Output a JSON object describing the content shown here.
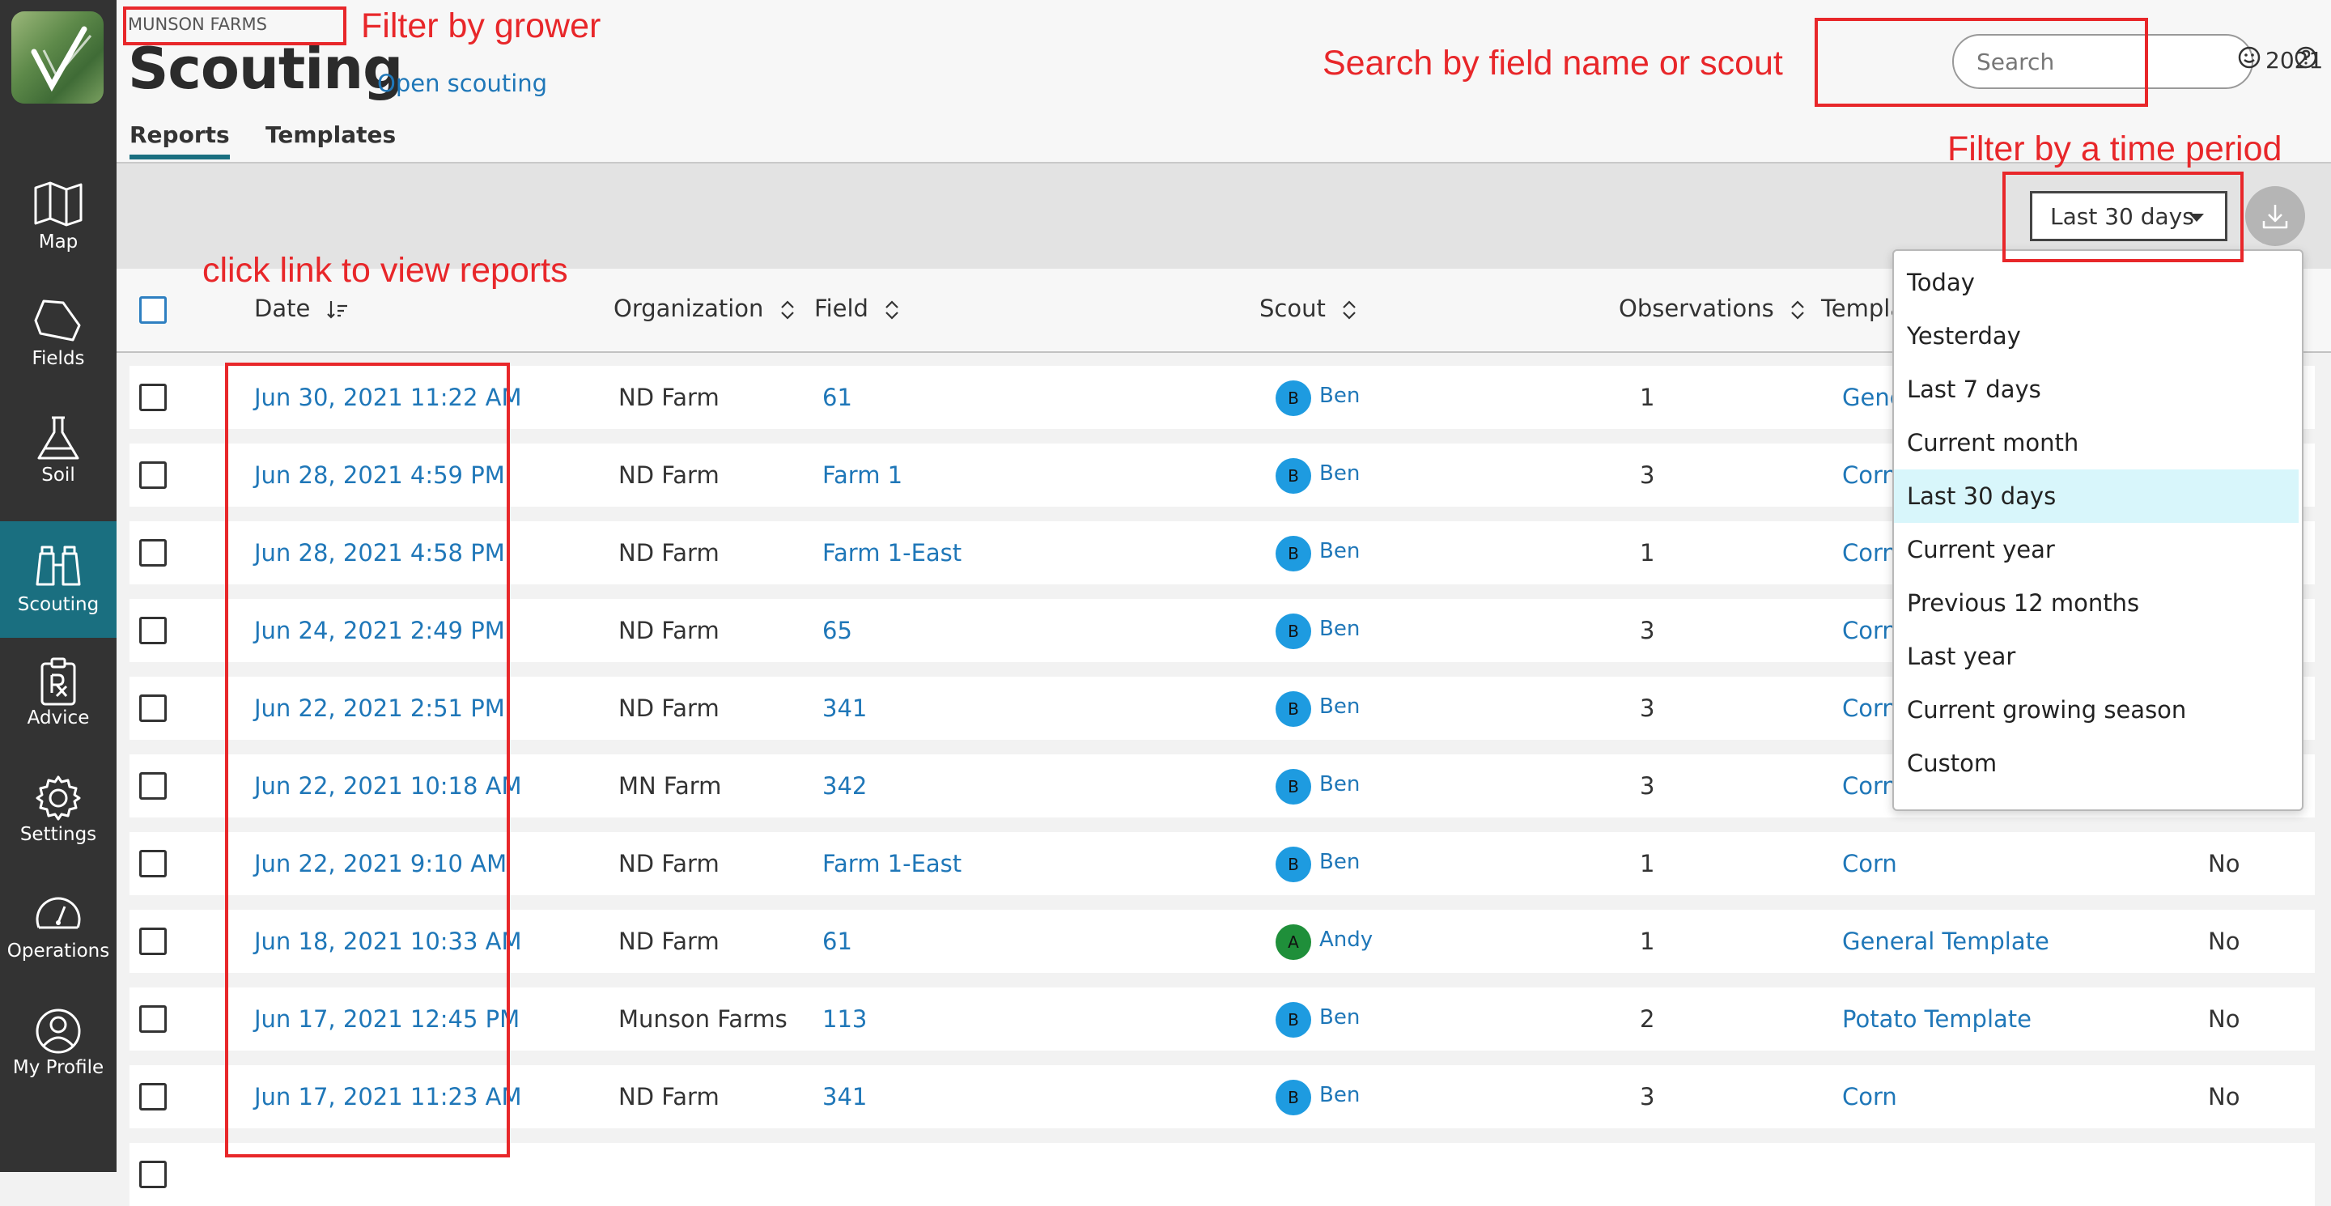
{
  "sidebar": {
    "items": [
      {
        "label": "Map",
        "icon": "map-icon"
      },
      {
        "label": "Fields",
        "icon": "fields-icon"
      },
      {
        "label": "Soil",
        "icon": "flask-icon"
      },
      {
        "label": "Scouting",
        "icon": "binoculars-icon",
        "active": true
      },
      {
        "label": "Advice",
        "icon": "prescription-icon"
      },
      {
        "label": "Settings",
        "icon": "gear-icon"
      },
      {
        "label": "Operations",
        "icon": "gauge-icon"
      },
      {
        "label": "My Profile",
        "icon": "user-icon"
      }
    ]
  },
  "header": {
    "grower": "MUNSON FARMS",
    "title": "Scouting",
    "open_link": "Open scouting",
    "search_placeholder": "Search",
    "year": "2021",
    "tabs": [
      {
        "label": "Reports",
        "active": true
      },
      {
        "label": "Templates"
      }
    ]
  },
  "toolbar": {
    "range_label": "Last 30 days"
  },
  "table": {
    "columns": [
      "Date",
      "Organization",
      "Field",
      "Scout",
      "Observations",
      "Templa"
    ],
    "rows": [
      {
        "date": "Jun 30, 2021 11:22 AM",
        "org": "ND Farm",
        "field": "61",
        "scout_initial": "B",
        "scout": "Ben",
        "obs": "1",
        "template": "Gene",
        "status": ""
      },
      {
        "date": "Jun 28, 2021 4:59 PM",
        "org": "ND Farm",
        "field": "Farm 1",
        "scout_initial": "B",
        "scout": "Ben",
        "obs": "3",
        "template": "Corn",
        "status": ""
      },
      {
        "date": "Jun 28, 2021 4:58 PM",
        "org": "ND Farm",
        "field": "Farm 1-East",
        "scout_initial": "B",
        "scout": "Ben",
        "obs": "1",
        "template": "Corn",
        "status": ""
      },
      {
        "date": "Jun 24, 2021 2:49 PM",
        "org": "ND Farm",
        "field": "65",
        "scout_initial": "B",
        "scout": "Ben",
        "obs": "3",
        "template": "Corn",
        "status": ""
      },
      {
        "date": "Jun 22, 2021 2:51 PM",
        "org": "ND Farm",
        "field": "341",
        "scout_initial": "B",
        "scout": "Ben",
        "obs": "3",
        "template": "Corn",
        "status": ""
      },
      {
        "date": "Jun 22, 2021 10:18 AM",
        "org": "MN Farm",
        "field": "342",
        "scout_initial": "B",
        "scout": "Ben",
        "obs": "3",
        "template": "Corn",
        "status": ""
      },
      {
        "date": "Jun 22, 2021 9:10 AM",
        "org": "ND Farm",
        "field": "Farm 1-East",
        "scout_initial": "B",
        "scout": "Ben",
        "obs": "1",
        "template": "Corn",
        "status": "No"
      },
      {
        "date": "Jun 18, 2021 10:33 AM",
        "org": "ND Farm",
        "field": "61",
        "scout_initial": "A",
        "scout": "Andy",
        "obs": "1",
        "template": "General Template",
        "status": "No"
      },
      {
        "date": "Jun 17, 2021 12:45 PM",
        "org": "Munson Farms",
        "field": "113",
        "scout_initial": "B",
        "scout": "Ben",
        "obs": "2",
        "template": "Potato Template",
        "status": "No"
      },
      {
        "date": "Jun 17, 2021 11:23 AM",
        "org": "ND Farm",
        "field": "341",
        "scout_initial": "B",
        "scout": "Ben",
        "obs": "3",
        "template": "Corn",
        "status": "No"
      }
    ]
  },
  "dropdown": {
    "options": [
      "Today",
      "Yesterday",
      "Last 7 days",
      "Current month",
      "Last 30 days",
      "Current year",
      "Previous 12 months",
      "Last year",
      "Current growing season",
      "Custom"
    ],
    "selected": "Last 30 days"
  },
  "annotations": {
    "grower": "Filter by grower",
    "search": "Search by field name or scout",
    "time": "Filter by a time period",
    "reports": "click link to view reports"
  },
  "colors": {
    "link": "#1f77b8",
    "accent": "#1a6f80",
    "annotation": "#e8272a",
    "avatar_b": "#1e9be0",
    "avatar_a": "#1f8f3a"
  }
}
